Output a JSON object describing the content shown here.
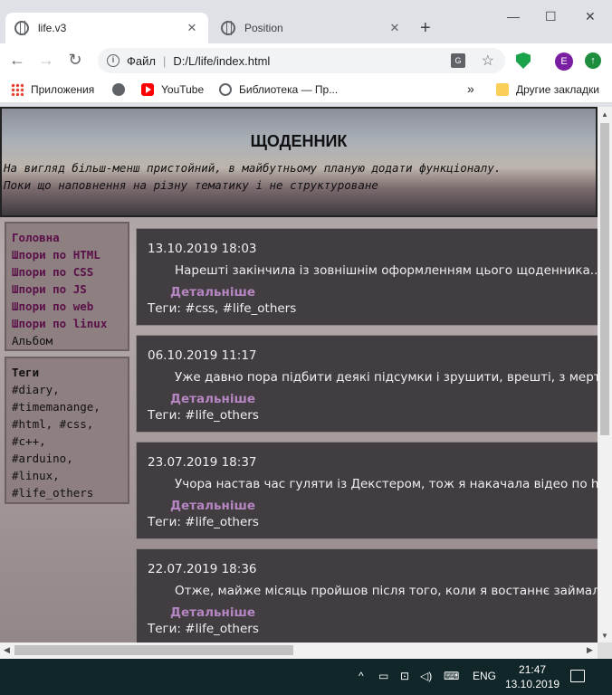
{
  "browser": {
    "tabs": [
      {
        "title": "life.v3",
        "active": true
      },
      {
        "title": "Position",
        "active": false
      }
    ],
    "address": {
      "scheme_label": "Файл",
      "url": "D:/L/life/index.html"
    },
    "profile_initial": "E",
    "translate_label": "G",
    "bookmarks": [
      {
        "label": "Приложения",
        "icon": "apps-icon"
      },
      {
        "label": "",
        "icon": "globe-icon"
      },
      {
        "label": "YouTube",
        "icon": "youtube-icon"
      },
      {
        "label": "Библиотека — Пр...",
        "icon": "library-icon"
      }
    ],
    "bookmarks_overflow": "»",
    "other_bookmarks": "Другие закладки"
  },
  "page": {
    "header": {
      "title": "ЩОДЕННИК",
      "description_line1": "На вигляд більш-менш пристойний, в майбутньому планую додати функціоналу.",
      "description_line2": "Поки що наповнення на різну тематику і не структуроване"
    },
    "nav": {
      "items": [
        {
          "label": "Головна",
          "link": true
        },
        {
          "label": "Шпори по HTML",
          "link": true
        },
        {
          "label": "Шпори по CSS",
          "link": true
        },
        {
          "label": "Шпори по JS",
          "link": true
        },
        {
          "label": "Шпори по web",
          "link": true
        },
        {
          "label": "Шпори по linux",
          "link": true
        },
        {
          "label": "Альбом",
          "link": false
        }
      ]
    },
    "tags": {
      "title": "Теги",
      "lines": [
        "#diary,",
        "#timemanange,",
        "#html, #css,",
        "#c++,",
        "#arduino,",
        "#linux,",
        "#life_others"
      ]
    },
    "posts": [
      {
        "date": "13.10.2019 18:03",
        "excerpt": "Нарешті закінчила із зовнішнім оформленням цього щоденника...",
        "more": "Детальніше",
        "tags": "Теги: #css, #life_others"
      },
      {
        "date": "06.10.2019 11:17",
        "excerpt": "Уже давно пора підбити деякі підсумки і зрушити, врешті, з мертвої",
        "more": "Детальніше",
        "tags": "Теги: #life_others"
      },
      {
        "date": "23.07.2019 18:37",
        "excerpt": "Учора настав час гуляти із Декстером, тож я накачала відео по html",
        "more": "Детальніше",
        "tags": "Теги: #life_others"
      },
      {
        "date": "22.07.2019 18:36",
        "excerpt": "Отже, майже місяць пройшов після того, коли я востаннє займалася",
        "more": "Детальніше",
        "tags": "Теги: #life_others"
      }
    ]
  },
  "taskbar": {
    "language": "ENG",
    "time": "21:47",
    "date": "13.10.2019"
  }
}
